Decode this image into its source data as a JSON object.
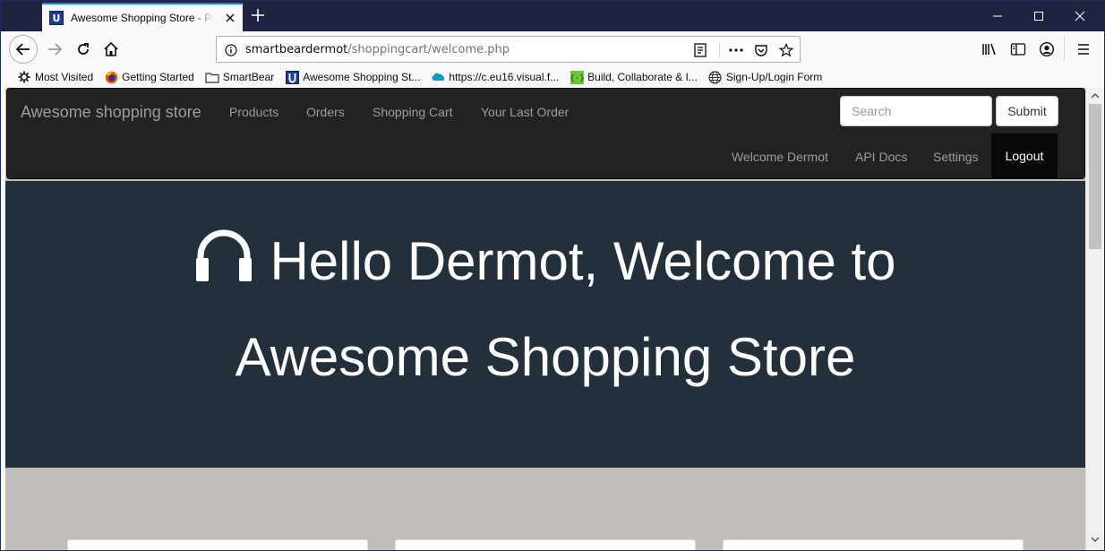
{
  "browser": {
    "tab_title": "Awesome Shopping Store - Pro",
    "tab_favicon_letter": "U",
    "url_host": "smartbeardermot",
    "url_path": "/shoppingcart/welcome.php",
    "bookmarks": [
      {
        "label": "Most Visited",
        "icon": "gear-icon"
      },
      {
        "label": "Getting Started",
        "icon": "firefox-icon"
      },
      {
        "label": "SmartBear",
        "icon": "folder-icon"
      },
      {
        "label": "Awesome Shopping St...",
        "icon": "store-favicon-icon"
      },
      {
        "label": "https://c.eu16.visual.f...",
        "icon": "salesforce-cloud-icon"
      },
      {
        "label": "Build, Collaborate & I...",
        "icon": "code-braces-icon"
      },
      {
        "label": "Sign-Up/Login Form",
        "icon": "globe-icon"
      }
    ]
  },
  "site": {
    "brand": "Awesome shopping store",
    "nav": [
      "Products",
      "Orders",
      "Shopping Cart",
      "Your Last Order"
    ],
    "search_placeholder": "Search",
    "submit_label": "Submit",
    "nav_right": [
      "Welcome Dermot",
      "API Docs",
      "Settings"
    ],
    "logout_label": "Logout"
  },
  "hero": {
    "line1": "Hello Dermot, Welcome to",
    "line2": "Awesome Shopping Store",
    "icon": "headphones-icon"
  },
  "colors": {
    "navbar_bg": "#222222",
    "hero_bg": "#232f3b",
    "page_bg": "#c1bdba",
    "tabbar_bg": "#202340",
    "accent": "#0a84ff"
  }
}
